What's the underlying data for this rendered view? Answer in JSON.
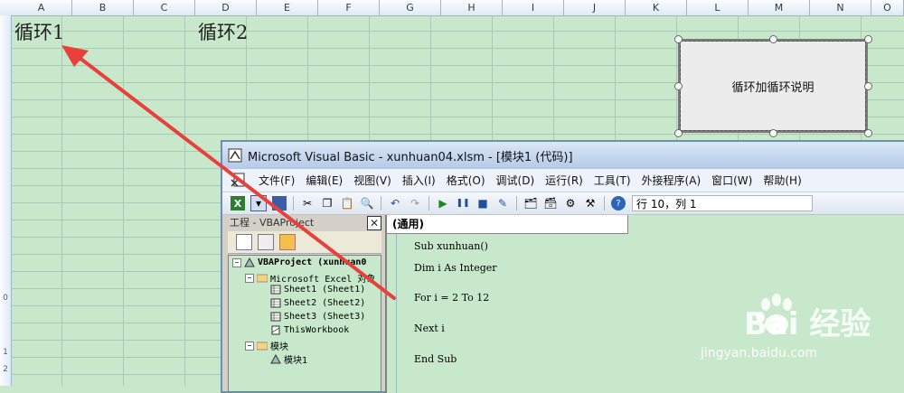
{
  "spreadsheet": {
    "columns": [
      "A",
      "B",
      "C",
      "D",
      "E",
      "F",
      "G",
      "H",
      "I",
      "J",
      "K",
      "L",
      "M",
      "N",
      "O"
    ],
    "row_labels_visible": [
      "0",
      "1",
      "2"
    ],
    "cell_a1": "循环1",
    "cell_d1": "循环2",
    "shape_label": "循环加循环说明",
    "background_color": "#c7e8cb"
  },
  "vbe": {
    "title": "Microsoft Visual Basic - xunhuan04.xlsm - [模块1 (代码)]",
    "menu": [
      "文件(F)",
      "编辑(E)",
      "视图(V)",
      "插入(I)",
      "格式(O)",
      "调试(D)",
      "运行(R)",
      "工具(T)",
      "外接程序(A)",
      "窗口(W)",
      "帮助(H)"
    ],
    "toolbar_position": "行 10，列 1",
    "project_pane": {
      "title": "工程 - VBAProject",
      "close_glyph": "✕",
      "tree": [
        {
          "label": "VBAProject (xunhuan0",
          "level": 0,
          "expander": "−"
        },
        {
          "label": "Microsoft Excel 对象",
          "level": 1,
          "expander": "−"
        },
        {
          "label": "Sheet1 (Sheet1)",
          "level": 2
        },
        {
          "label": "Sheet2 (Sheet2)",
          "level": 2
        },
        {
          "label": "Sheet3 (Sheet3)",
          "level": 2
        },
        {
          "label": "ThisWorkbook",
          "level": 2
        },
        {
          "label": "模块",
          "level": 1,
          "expander": "−"
        },
        {
          "label": "模块1",
          "level": 2
        }
      ]
    },
    "code_pane": {
      "object_combo": "(通用)",
      "lines": [
        "Sub xunhuan()",
        "Dim i As Integer",
        "For i = 2 To 12",
        "Next i",
        "End Sub"
      ]
    }
  },
  "watermark": {
    "brand": "Bai  经验",
    "url": "jingyan.baidu.com"
  },
  "annotation": {
    "arrow_color": "#e8403a"
  }
}
